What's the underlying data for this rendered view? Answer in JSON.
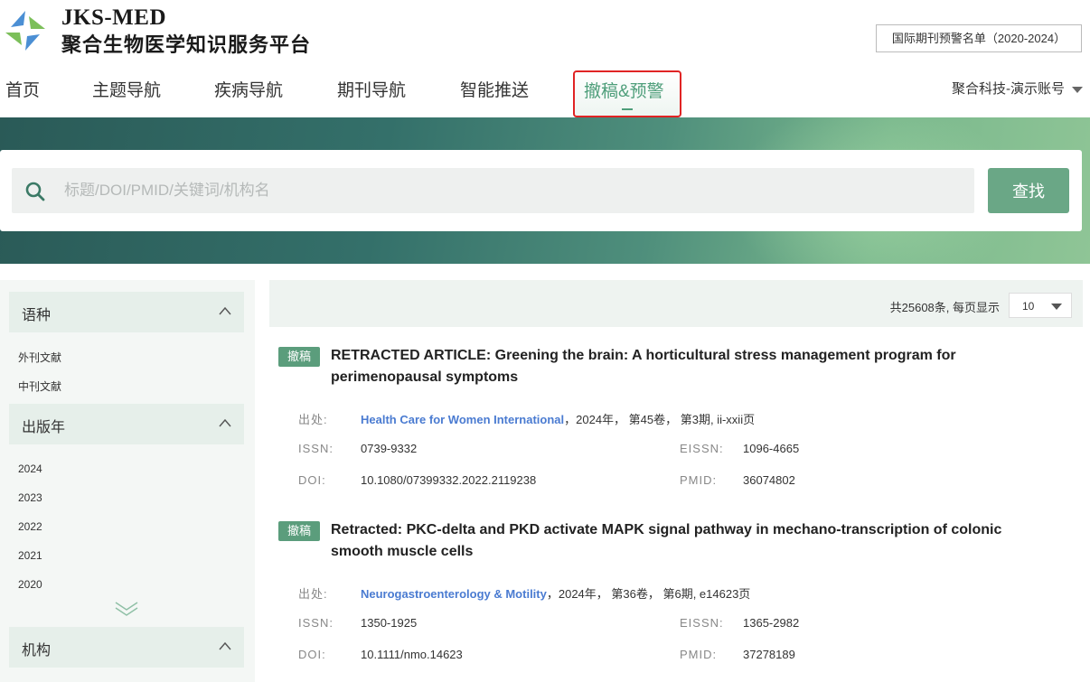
{
  "header": {
    "brand_en": "JKS-MED",
    "brand_cn": "聚合生物医学知识服务平台",
    "warn_list_button": "国际期刊预警名单（2020-2024）",
    "account": "聚合科技-演示账号"
  },
  "nav": {
    "items": [
      "首页",
      "主题导航",
      "疾病导航",
      "期刊导航",
      "智能推送",
      "撤稿&预警"
    ],
    "active_index": 5
  },
  "search": {
    "placeholder": "标题/DOI/PMID/关键词/机构名",
    "value": "",
    "button": "查找"
  },
  "sidebar": {
    "facets": [
      {
        "label": "语种",
        "items": [
          "外刊文献",
          "中刊文献"
        ]
      },
      {
        "label": "出版年",
        "items": [
          "2024",
          "2023",
          "2022",
          "2021",
          "2020"
        ]
      },
      {
        "label": "机构",
        "items": []
      }
    ]
  },
  "results": {
    "total_text": "共25608条, 每页显示",
    "page_size": "10",
    "labels": {
      "source": "出处:",
      "issn": "ISSN:",
      "eissn": "EISSN:",
      "doi": "DOI:",
      "pmid": "PMID:"
    },
    "articles": [
      {
        "tag": "撤稿",
        "title": "RETRACTED ARTICLE: Greening the brain: A horticultural stress management program for perimenopausal symptoms",
        "journal": "Health Care for Women International",
        "source_detail": "，2024年， 第45卷， 第3期,  ii-xxii页",
        "issn": "0739-9332",
        "eissn": "1096-4665",
        "doi": "10.1080/07399332.2022.2119238",
        "pmid": "36074802"
      },
      {
        "tag": "撤稿",
        "title": "Retracted: PKC-delta and PKD activate MAPK signal pathway in mechano-transcription of colonic smooth muscle cells",
        "journal": "Neurogastroenterology & Motility",
        "source_detail": "，2024年， 第36卷， 第6期,  e14623页",
        "issn": "1350-1925",
        "eissn": "1365-2982",
        "doi": "10.1111/nmo.14623",
        "pmid": "37278189"
      }
    ]
  },
  "colors": {
    "accent": "#4e9e7a",
    "button": "#6aa786",
    "link": "#4a7bd1",
    "highlight_border": "#e02424"
  }
}
